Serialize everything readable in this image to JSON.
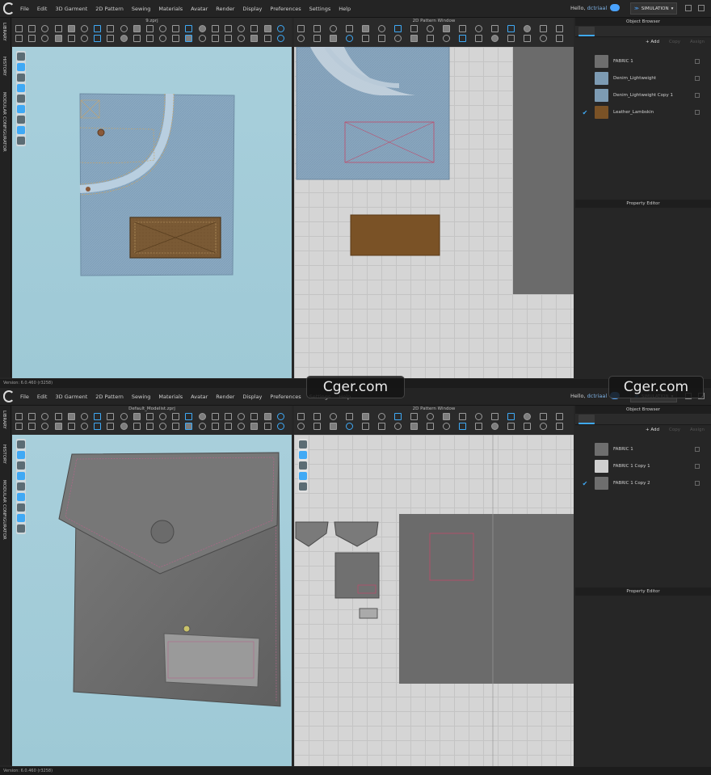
{
  "menus": [
    "File",
    "Edit",
    "3D Garment",
    "2D Pattern",
    "Sewing",
    "Materials",
    "Avatar",
    "Render",
    "Display",
    "Preferences",
    "Settings",
    "Help"
  ],
  "user": {
    "greeting": "Hello,",
    "name": "dctriaal"
  },
  "simulation_label": "SIMULATION",
  "side_tabs": [
    "LIBRARY",
    "HISTORY",
    "MODULAR CONFIGURATOR"
  ],
  "object_browser": {
    "title": "Object Browser",
    "add_label": "+ Add",
    "copy_label": "Copy",
    "assign_label": "Assign"
  },
  "property_editor": "Property Editor",
  "pattern_window_title": "2D Pattern Window",
  "version": "Version: 6.0.460 (r3258)",
  "watermark": "Cger.com",
  "windowA": {
    "file": "9.zprj",
    "fabrics": [
      {
        "name": "FABRIC 1",
        "color": "#6e6e6e",
        "checked": false
      },
      {
        "name": "Denim_Lightweight",
        "color": "#7d9bb3",
        "checked": false
      },
      {
        "name": "Denim_Lightweight Copy 1",
        "color": "#7d9bb3",
        "checked": false
      },
      {
        "name": "Leather_Lambskin",
        "color": "#7a5226",
        "checked": true
      }
    ]
  },
  "windowB": {
    "file": "Default_Modelist.zprj",
    "fabrics": [
      {
        "name": "FABRIC 1",
        "color": "#6e6e6e",
        "checked": false
      },
      {
        "name": "FABRIC 1 Copy 1",
        "color": "#cfcfcf",
        "checked": false
      },
      {
        "name": "FABRIC 1 Copy 2",
        "color": "#6e6e6e",
        "checked": true
      }
    ]
  },
  "colors": {
    "accent": "#3fa9f5",
    "viewport_bg": "#a8cfdb",
    "pattern_bg": "#d5d5d5",
    "denim": "#88a7c0",
    "leather": "#7a5226",
    "gray_fabric": "#6b6b6b"
  }
}
